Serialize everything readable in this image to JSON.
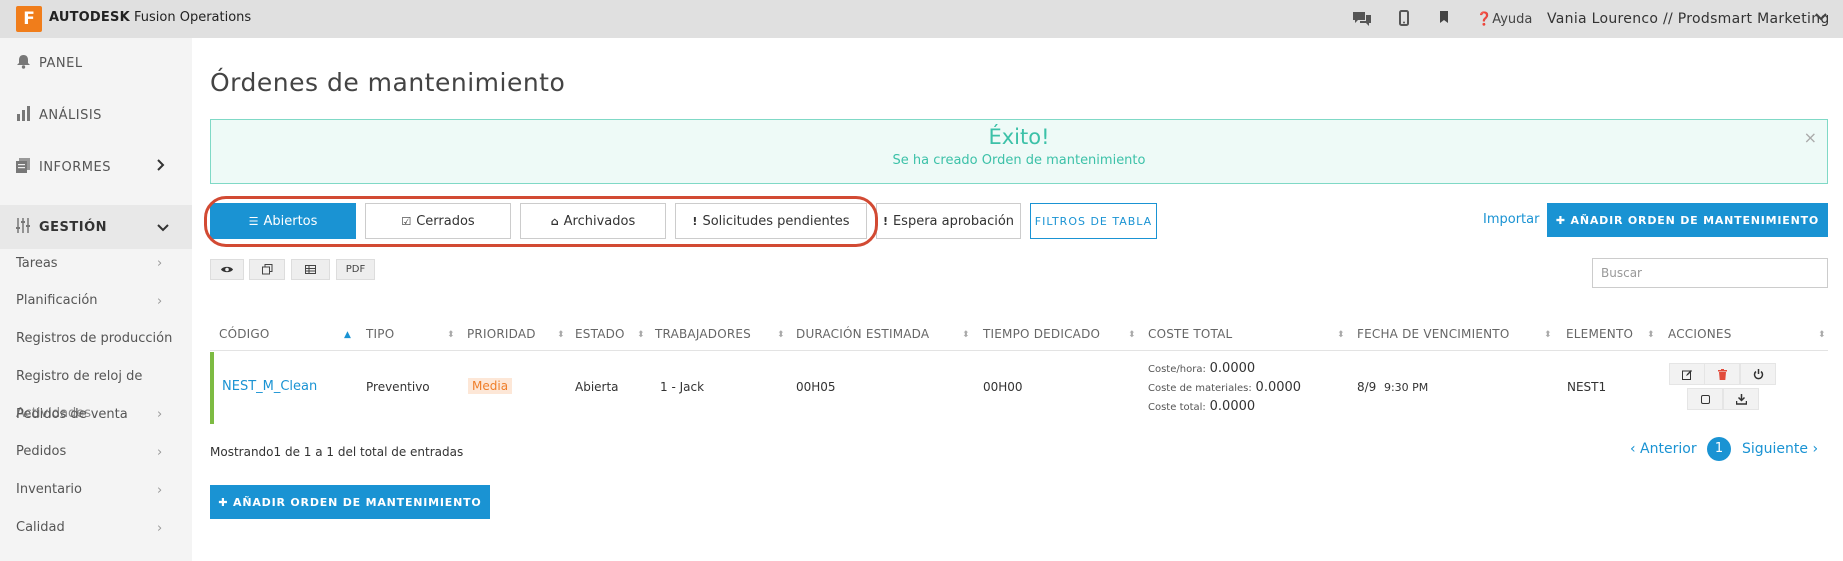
{
  "topbar": {
    "logo_letter": "F",
    "brand_bold": "AUTODESK",
    "brand_rest": "Fusion Operations",
    "help": "Ayuda",
    "user": "Vania Lourenco // Prodsmart Marketing",
    "icons": [
      "chat-icon",
      "mobile-icon",
      "bookmark-icon",
      "help-icon",
      "chevron-down-icon"
    ]
  },
  "sidebar": {
    "panel": "PANEL",
    "analisis": "ANÁLISIS",
    "informes": "INFORMES",
    "gestion": "GESTIÓN",
    "sub": [
      {
        "label": "Tareas"
      },
      {
        "label": "Planificación"
      },
      {
        "label": "Registros de producción"
      },
      {
        "label": "Registro de reloj de"
      },
      {
        "label": "Pedidos de venta",
        "overlap": "Actividades"
      },
      {
        "label": "Pedidos"
      },
      {
        "label": "Inventario"
      },
      {
        "label": "Calidad"
      }
    ]
  },
  "page": {
    "title": "Órdenes de mantenimiento"
  },
  "alert": {
    "title": "Éxito!",
    "message": "Se ha creado Orden de mantenimiento",
    "close": "×"
  },
  "tabs": [
    {
      "label": "Abiertos",
      "icon": "list-icon"
    },
    {
      "label": "Cerrados",
      "icon": "check-square-icon"
    },
    {
      "label": "Archivados",
      "icon": "inbox-icon"
    },
    {
      "label": "Solicitudes pendientes",
      "icon": "exclamation-icon"
    },
    {
      "label": "Espera aprobación",
      "icon": "exclamation-icon"
    }
  ],
  "toolbar": {
    "filters": "FILTROS DE TABLA",
    "import": "Importar",
    "add": "✚ AÑADIR ORDEN DE MANTENIMIENTO",
    "pdf": "PDF",
    "search_placeholder": "Buscar"
  },
  "table": {
    "headers": [
      "CÓDIGO",
      "TIPO",
      "PRIORIDAD",
      "ESTADO",
      "TRABAJADORES",
      "DURACIÓN ESTIMADA",
      "TIEMPO DEDICADO",
      "COSTE TOTAL",
      "FECHA DE VENCIMIENTO",
      "ELEMENTO",
      "ACCIONES"
    ],
    "rows": [
      {
        "codigo": "NEST_M_Clean",
        "tipo": "Preventivo",
        "prioridad": "Media",
        "estado": "Abierta",
        "trabajadores": "1 - Jack",
        "duracion": "00H05",
        "tiempo": "00H00",
        "coste_hora_lbl": "Coste/hora:",
        "coste_hora": "0.0000",
        "coste_mat_lbl": "Coste de materiales:",
        "coste_mat": "0.0000",
        "coste_total_lbl": "Coste total:",
        "coste_total": "0.0000",
        "fecha_dia": "8/9",
        "fecha_hora": "9:30 PM",
        "elemento": "NEST1"
      }
    ]
  },
  "footer": {
    "entries": "Mostrando1 de 1 a 1 del total de entradas",
    "prev": "‹ Anterior",
    "page": "1",
    "next": "Siguiente ›"
  },
  "colors": {
    "accent": "#1a93d3",
    "success": "#3cc1a8",
    "highlight": "#d24a33",
    "priority_medium": "#ef7e2a",
    "row_accent": "#7dbb42"
  }
}
